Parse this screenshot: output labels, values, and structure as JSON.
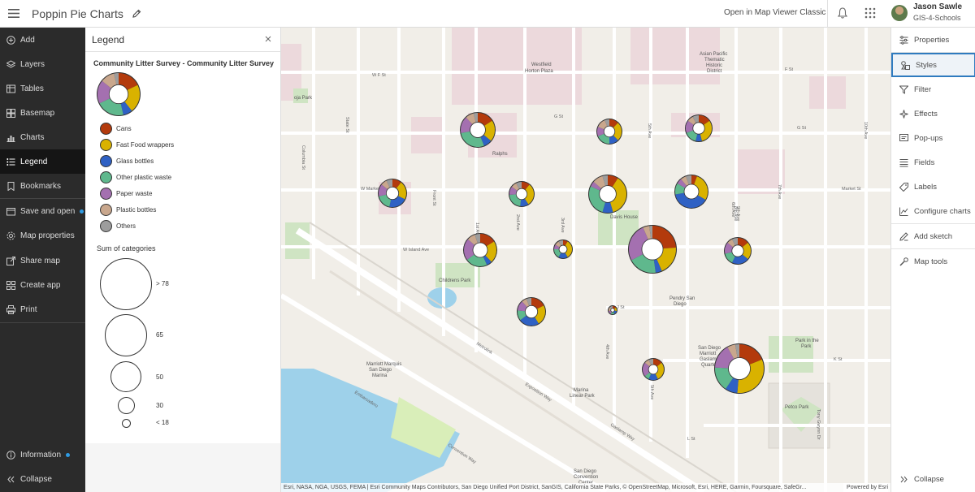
{
  "header": {
    "title": "Poppin Pie Charts",
    "classic_link": "Open in Map Viewer Classic",
    "user_name": "Jason Sawle",
    "user_org": "GIS-4-Schools"
  },
  "left_toolbar": {
    "items": [
      {
        "label": "Add",
        "icon": "add-icon"
      },
      {
        "label": "Layers",
        "icon": "layers-icon"
      },
      {
        "label": "Tables",
        "icon": "table-icon"
      },
      {
        "label": "Basemap",
        "icon": "basemap-icon"
      },
      {
        "label": "Charts",
        "icon": "chart-icon"
      },
      {
        "label": "Legend",
        "icon": "legend-icon"
      },
      {
        "label": "Bookmarks",
        "icon": "bookmark-icon"
      },
      {
        "label": "Save and open",
        "icon": "save-icon"
      },
      {
        "label": "Map properties",
        "icon": "gear-icon"
      },
      {
        "label": "Share map",
        "icon": "share-icon"
      },
      {
        "label": "Create app",
        "icon": "apps-icon"
      },
      {
        "label": "Print",
        "icon": "print-icon"
      }
    ],
    "information": "Information",
    "collapse": "Collapse"
  },
  "legend": {
    "title": "Legend",
    "layer_title": "Community Litter Survey - Community Litter Survey",
    "categories": [
      {
        "label": "Cans",
        "color": "#b33a0c"
      },
      {
        "label": "Fast Food wrappers",
        "color": "#d9b200"
      },
      {
        "label": "Glass bottles",
        "color": "#2f61c4"
      },
      {
        "label": "Other plastic waste",
        "color": "#5fb88d"
      },
      {
        "label": "Paper waste",
        "color": "#a470b0"
      },
      {
        "label": "Plastic bottles",
        "color": "#c9a78d"
      },
      {
        "label": "Others",
        "color": "#9d9d9d"
      }
    ],
    "size_title": "Sum of categories",
    "size_classes": [
      "> 78",
      "65",
      "50",
      "30",
      "< 18"
    ]
  },
  "right_toolbar": {
    "items": [
      {
        "label": "Properties",
        "icon": "properties-icon"
      },
      {
        "label": "Styles",
        "icon": "styles-icon"
      },
      {
        "label": "Filter",
        "icon": "filter-icon"
      },
      {
        "label": "Effects",
        "icon": "effects-icon"
      },
      {
        "label": "Pop-ups",
        "icon": "popup-icon"
      },
      {
        "label": "Fields",
        "icon": "fields-icon"
      },
      {
        "label": "Labels",
        "icon": "label-icon"
      },
      {
        "label": "Configure charts",
        "icon": "configure-charts-icon"
      },
      {
        "label": "Add sketch",
        "icon": "sketch-icon"
      },
      {
        "label": "Map tools",
        "icon": "tools-icon"
      }
    ],
    "collapse": "Collapse"
  },
  "map": {
    "attribution": "Esri, NASA, NGA, USGS, FEMA | Esri Community Maps Contributors, San Diego Unified Port District, SanGIS, California State Parks, © OpenStreetMap, Microsoft, Esri, HERE, Garmin, Foursquare, SafeGr...",
    "powered_by": "Powered by Esri",
    "labels": {
      "westfield": "Westfield",
      "horton": "Horton Plaza",
      "asian": "Asian Pacific",
      "thematic": "Thematic",
      "historic": "Historic",
      "district": "District",
      "ralphs": "Ralphs",
      "childrens": "Childrens Park",
      "davis": "Davis House",
      "pendry": "Pendry San",
      "diego": "Diego",
      "marriott1": "Marriott Marquis",
      "marriott2": "San Diego",
      "marriott3": "Marina",
      "marina1": "Marina",
      "marina2": "Linear Park",
      "gaslamp1": "San Diego",
      "gaslamp2": "Marriott",
      "gaslamp3": "Gaslamp",
      "gaslamp4": "Quarter",
      "park1": "Park in the",
      "park2": "Park",
      "petco": "Petco Park",
      "convention1": "San Diego",
      "convention2": "Convention",
      "convention3": "Center",
      "f_st": "F St",
      "g_st": "G St",
      "w_f_st": "W F St",
      "w_market": "W Market St",
      "market": "Market St",
      "island": "W Island Ave",
      "j_st": "J St",
      "harbor": "Harbor Dr",
      "metrolink": "Metrolink",
      "expo": "Exposition Way",
      "gaslamp_way": "Gaslamp Way",
      "embarcadero": "Embarcadero",
      "convention_way": "Convention Way",
      "state_st": "State St",
      "columbia": "Columbia St",
      "front": "Front St",
      "first": "1st Ave",
      "second": "2nd Ave",
      "third": "3rd Ave",
      "fourth": "4th Ave",
      "fifth": "5th Ave",
      "sixth": "6th Ave",
      "seventh": "7th Ave",
      "eighth": "8th Ave",
      "ninth": "9th Ave",
      "tenth": "10th Ave",
      "tony": "Tony Gwynn Dr",
      "soja": "oja Park",
      "l_st": "L St",
      "k_st": "K St"
    },
    "pies": [
      {
        "values": [
          8,
          10,
          4,
          14,
          8,
          4,
          2
        ]
      },
      {
        "values": [
          4,
          8,
          4,
          6,
          4,
          4,
          2
        ]
      },
      {
        "values": [
          4,
          8,
          2,
          4,
          4,
          2,
          2
        ]
      },
      {
        "values": [
          3,
          6,
          6,
          5,
          4,
          2,
          2
        ]
      },
      {
        "values": [
          3,
          8,
          3,
          6,
          3,
          2,
          2
        ]
      },
      {
        "values": [
          4,
          16,
          4,
          12,
          2,
          4,
          2
        ]
      },
      {
        "values": [
          2,
          10,
          14,
          4,
          2,
          2,
          2
        ]
      },
      {
        "values": [
          6,
          8,
          2,
          8,
          8,
          3,
          2
        ]
      },
      {
        "values": [
          2,
          8,
          4,
          4,
          2,
          2,
          2
        ]
      },
      {
        "values": [
          22,
          18,
          4,
          18,
          24,
          4,
          2
        ]
      },
      {
        "values": [
          4,
          6,
          6,
          4,
          4,
          2,
          2
        ]
      },
      {
        "values": [
          6,
          8,
          8,
          4,
          4,
          2,
          2
        ]
      },
      {
        "values": [
          2,
          2,
          2,
          2,
          2,
          2,
          2
        ]
      },
      {
        "values": [
          4,
          8,
          4,
          2,
          6,
          2,
          2
        ]
      },
      {
        "values": [
          14,
          24,
          6,
          12,
          12,
          4,
          2
        ]
      }
    ]
  }
}
